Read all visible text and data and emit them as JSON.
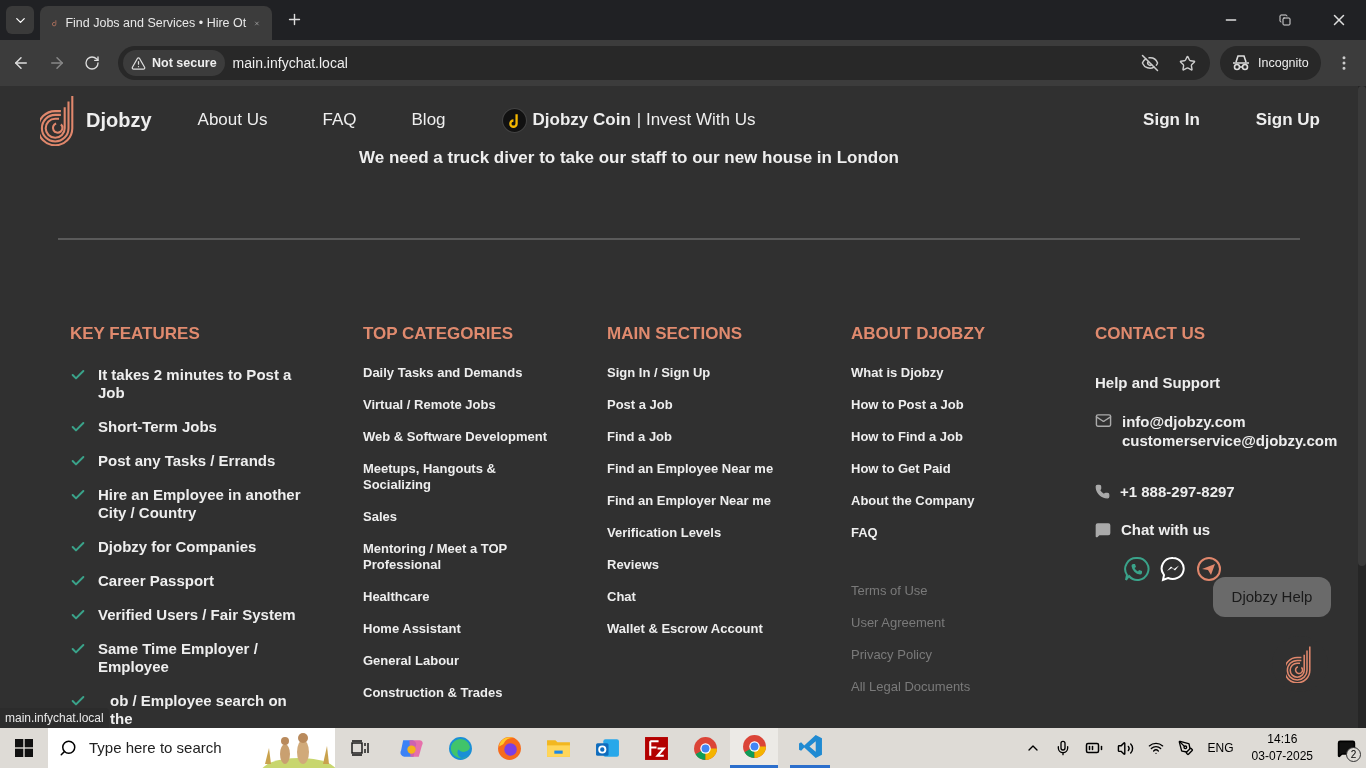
{
  "browser": {
    "tabs": [
      {
        "title": "Find Jobs and Services • Hire Ot",
        "selected": true
      }
    ],
    "address": {
      "security": "Not secure",
      "url": "main.infychat.local"
    },
    "profile": "Incognito"
  },
  "page": {
    "nav": {
      "brand": "Djobzy",
      "links": [
        "About Us",
        "FAQ",
        "Blog"
      ],
      "coin": {
        "name": "Djobzy Coin",
        "tagline": "| Invest With Us"
      },
      "auth": [
        "Sign In",
        "Sign Up"
      ]
    },
    "headline": "We need a truck diver to take our staff to our new house in London",
    "footer": {
      "key_features": {
        "title": "KEY FEATURES",
        "items": [
          "It takes 2 minutes to Post a Job",
          "Short-Term Jobs",
          "Post any Tasks / Errands",
          "Hire an Employee in another City / Country",
          "Djobzy for Companies",
          "Career Passport",
          "Verified Users / Fair System",
          "Same Time Employer / Employee",
          "ob / Employee search on the"
        ]
      },
      "top_categories": {
        "title": "TOP CATEGORIES",
        "items": [
          "Daily Tasks and Demands",
          "Virtual / Remote Jobs",
          "Web & Software Development",
          "Meetups, Hangouts & Socializing",
          "Sales",
          "Mentoring / Meet a TOP Professional",
          "Healthcare",
          "Home Assistant",
          "General Labour",
          "Construction & Trades"
        ]
      },
      "main_sections": {
        "title": "MAIN SECTIONS",
        "items": [
          "Sign In / Sign Up",
          "Post a Job",
          "Find a Job",
          "Find an Employee Near me",
          "Find an Employer Near me",
          "Verification Levels",
          "Reviews",
          "Chat",
          "Wallet & Escrow Account"
        ]
      },
      "about": {
        "title": "ABOUT DJOBZY",
        "items": [
          "What is Djobzy",
          "How to Post a Job",
          "How to Find a Job",
          "How to Get Paid",
          "About the Company",
          "FAQ"
        ],
        "legal": [
          "Terms of Use",
          "User Agreement",
          "Privacy Policy",
          "All Legal Documents"
        ]
      },
      "contact": {
        "title": "CONTACT US",
        "subtitle": "Help and Support",
        "emails": [
          "info@djobzy.com",
          "customerservice@djobzy.com"
        ],
        "phone": "+1 888-297-8297",
        "chat": "Chat with us"
      }
    },
    "help_tooltip": "Djobzy Help"
  },
  "status_url": "main.infychat.local",
  "taskbar": {
    "search_placeholder": "Type here to search",
    "language": "ENG",
    "time": "14:16",
    "date": "03-07-2025",
    "notifications": "2"
  }
}
